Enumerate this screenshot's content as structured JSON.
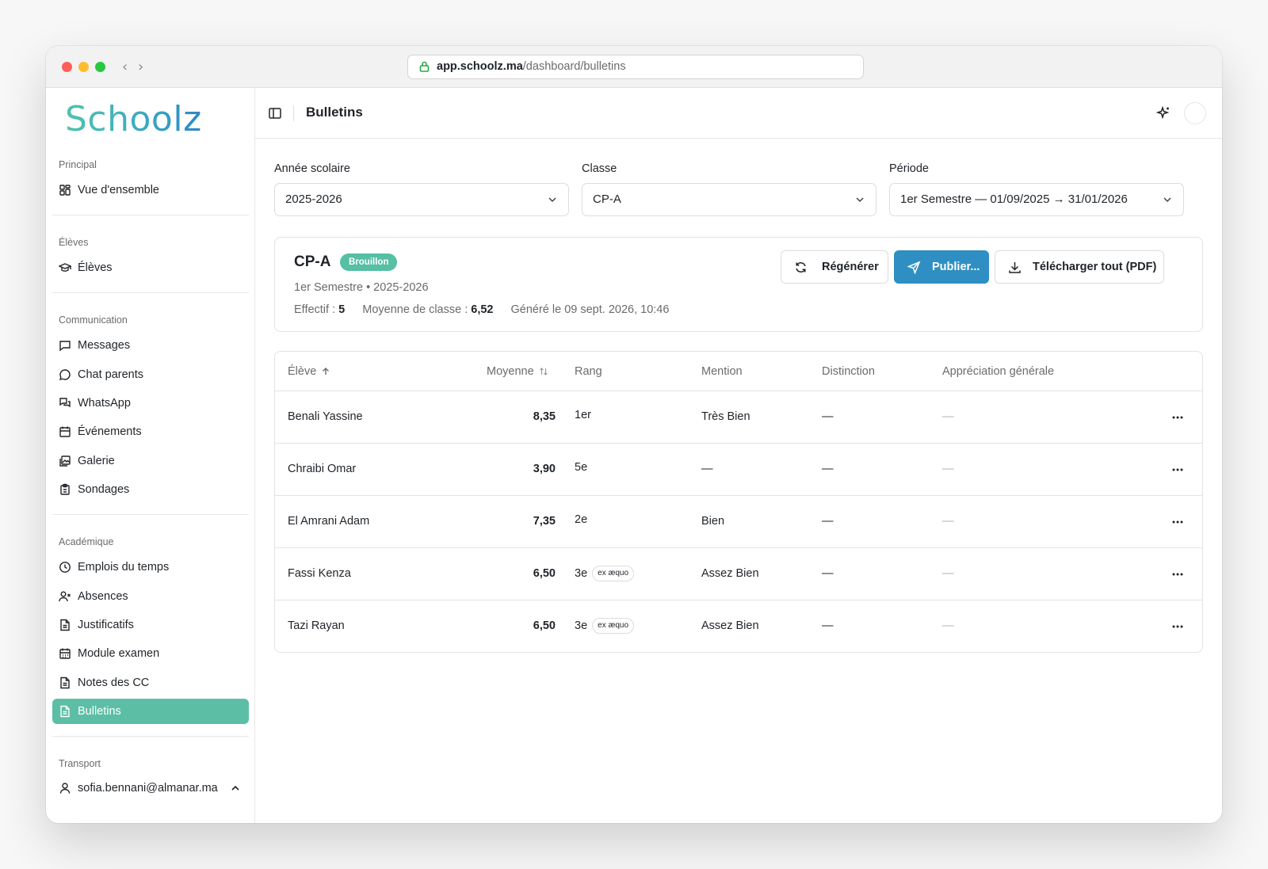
{
  "browser": {
    "url_host": "app.schoolz.ma",
    "url_path": "/dashboard/bulletins"
  },
  "sidebar": {
    "logo": "Schoolz",
    "sections": [
      {
        "label": "Principal",
        "items": [
          {
            "label": "Vue d'ensemble",
            "icon": "dashboard-icon"
          }
        ]
      },
      {
        "label": "Élèves",
        "items": [
          {
            "label": "Élèves",
            "icon": "graduation-cap-icon"
          }
        ]
      },
      {
        "label": "Communication",
        "items": [
          {
            "label": "Messages",
            "icon": "message-square-icon"
          },
          {
            "label": "Chat parents",
            "icon": "message-circle-icon"
          },
          {
            "label": "WhatsApp",
            "icon": "messages-icon"
          },
          {
            "label": "Événements",
            "icon": "calendar-icon"
          },
          {
            "label": "Galerie",
            "icon": "images-icon"
          },
          {
            "label": "Sondages",
            "icon": "clipboard-icon"
          }
        ]
      },
      {
        "label": "Académique",
        "items": [
          {
            "label": "Emplois du temps",
            "icon": "clock-icon"
          },
          {
            "label": "Absences",
            "icon": "user-x-icon"
          },
          {
            "label": "Justificatifs",
            "icon": "file-text-icon"
          },
          {
            "label": "Module examen",
            "icon": "calendar-days-icon"
          },
          {
            "label": "Notes des CC",
            "icon": "file-text-icon"
          },
          {
            "label": "Bulletins",
            "icon": "file-text-icon",
            "active": true
          }
        ]
      },
      {
        "label": "Transport",
        "items": []
      }
    ],
    "user_email": "sofia.bennani@almanar.ma"
  },
  "topbar": {
    "title": "Bulletins"
  },
  "filters": {
    "year": {
      "label": "Année scolaire",
      "value": "2025-2026"
    },
    "class": {
      "label": "Classe",
      "value": "CP-A"
    },
    "period": {
      "label": "Période",
      "value": "1er Semestre — 01/09/2025 → 31/01/2026"
    }
  },
  "summary": {
    "class_name": "CP-A",
    "status_badge": "Brouillon",
    "subtitle": "1er Semestre • 2025-2026",
    "effectif_label": "Effectif :",
    "effectif_value": "5",
    "moyenne_label": "Moyenne de classe :",
    "moyenne_value": "6,52",
    "generated": "Généré le 09 sept. 2026, 10:46",
    "buttons": {
      "regenerate": "Régénérer",
      "publish": "Publier...",
      "download": "Télécharger tout (PDF)"
    }
  },
  "table": {
    "headers": {
      "student": "Élève",
      "average": "Moyenne",
      "rank": "Rang",
      "mention": "Mention",
      "distinction": "Distinction",
      "appreciation": "Appréciation générale"
    },
    "rows": [
      {
        "name": "Benali Yassine",
        "average": "8,35",
        "rank": "1er",
        "ex_aequo": "",
        "mention": "Très Bien",
        "distinction": "—",
        "appreciation": "—"
      },
      {
        "name": "Chraibi Omar",
        "average": "3,90",
        "rank": "5e",
        "ex_aequo": "",
        "mention": "—",
        "distinction": "—",
        "appreciation": "—"
      },
      {
        "name": "El Amrani Adam",
        "average": "7,35",
        "rank": "2e",
        "ex_aequo": "",
        "mention": "Bien",
        "distinction": "—",
        "appreciation": "—"
      },
      {
        "name": "Fassi Kenza",
        "average": "6,50",
        "rank": "3e",
        "ex_aequo": "ex æquo",
        "mention": "Assez Bien",
        "distinction": "—",
        "appreciation": "—"
      },
      {
        "name": "Tazi Rayan",
        "average": "6,50",
        "rank": "3e",
        "ex_aequo": "ex æquo",
        "mention": "Assez Bien",
        "distinction": "—",
        "appreciation": "—"
      }
    ]
  },
  "colors": {
    "accent_green": "#5cbfa5",
    "primary_blue": "#2f8fc3",
    "badge_green": "#56bfa4"
  }
}
